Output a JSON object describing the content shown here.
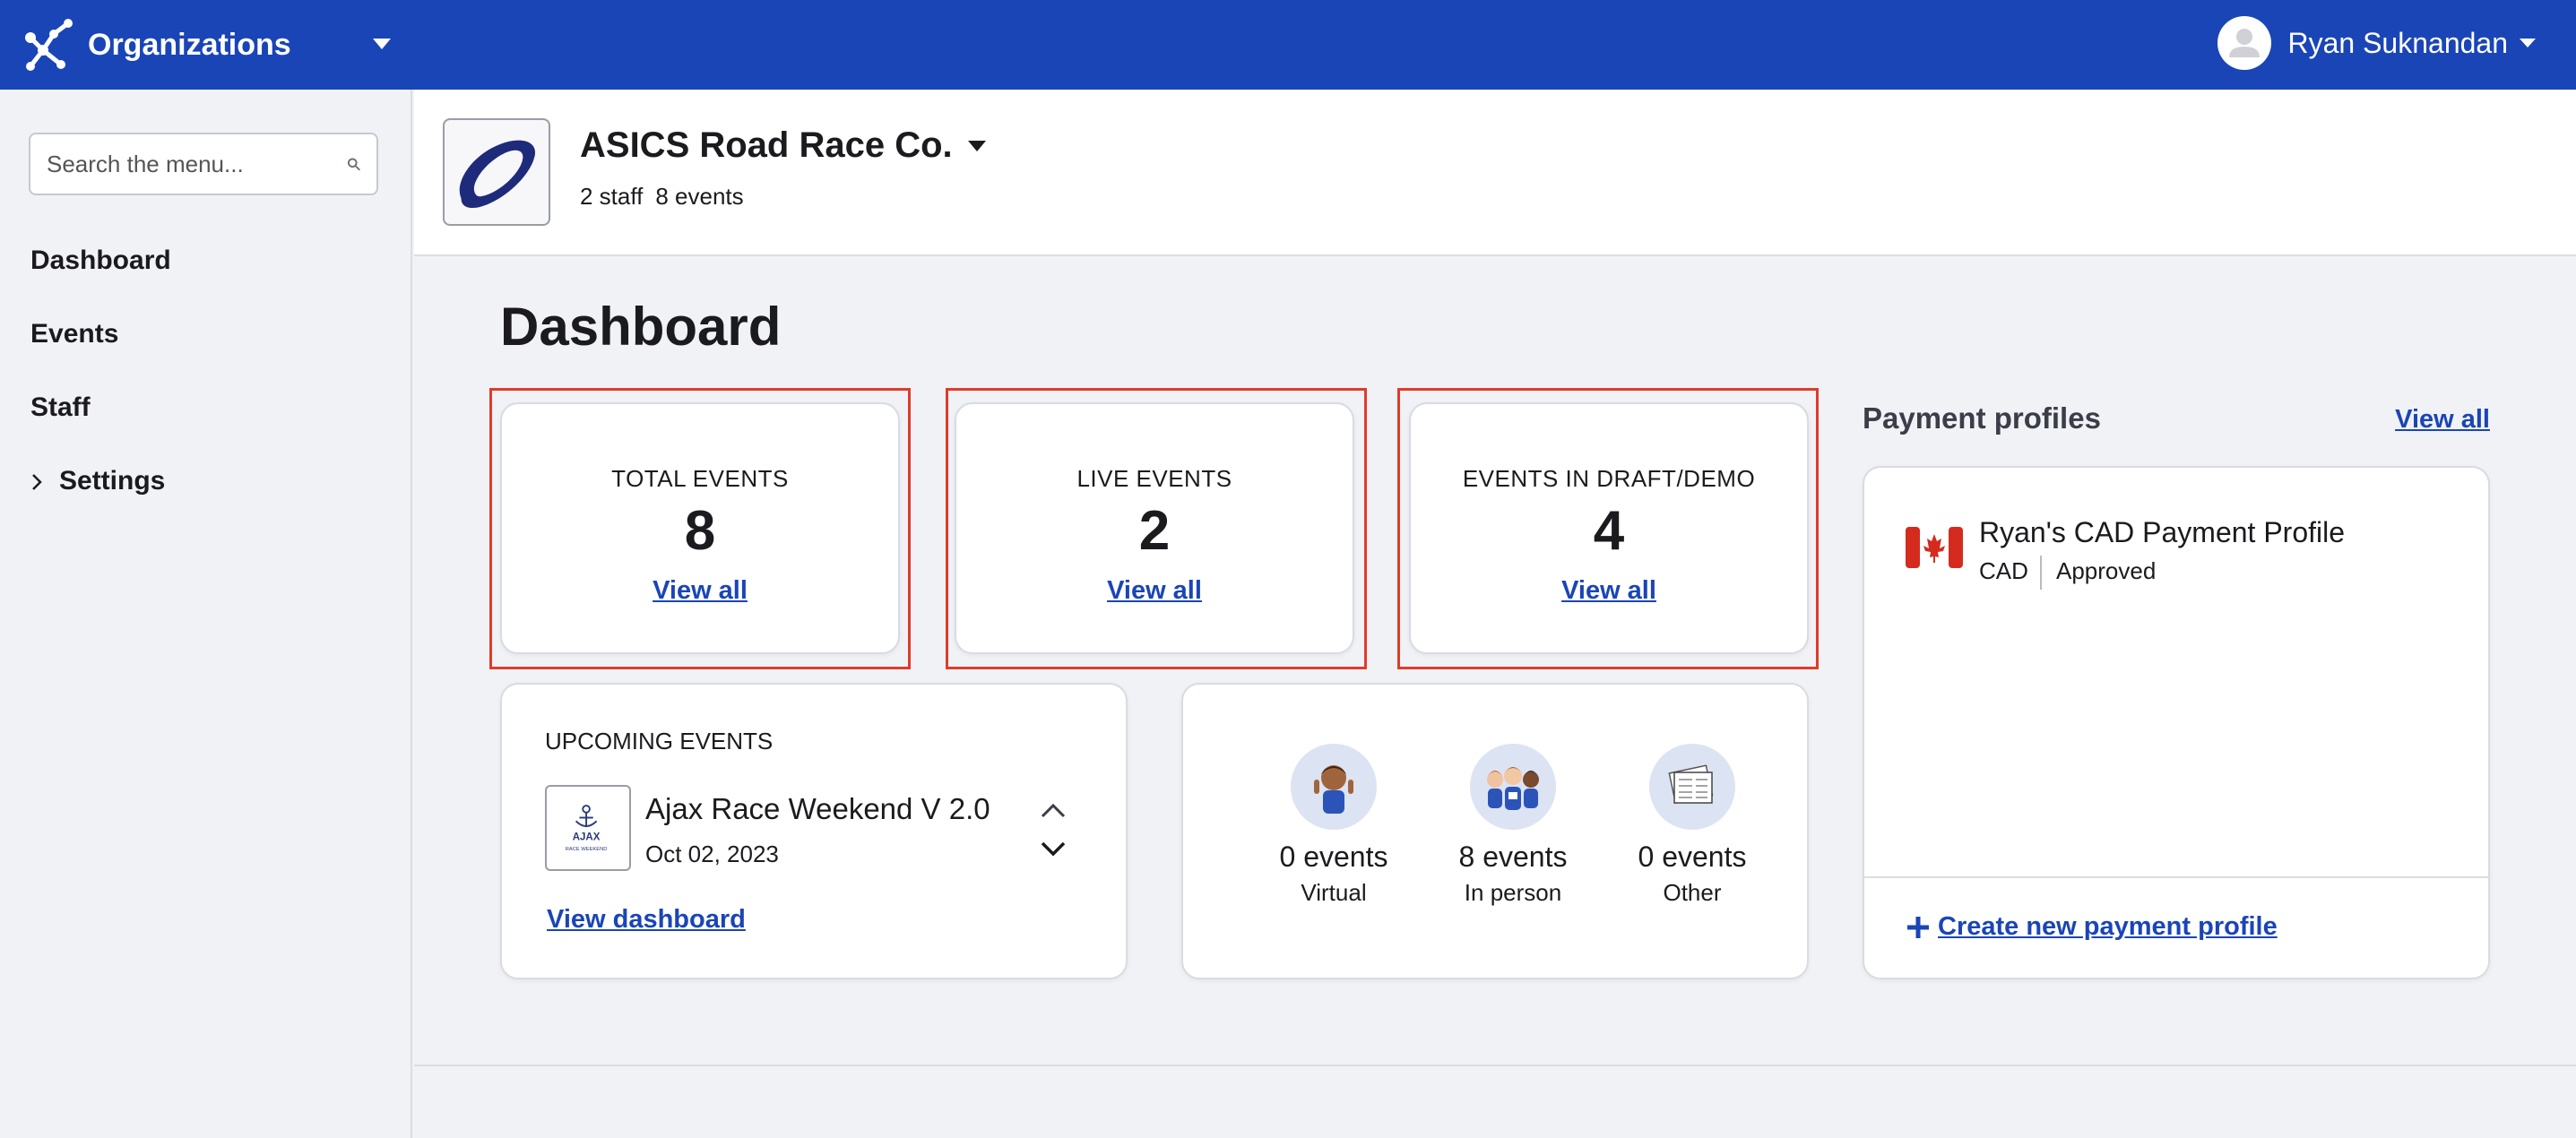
{
  "topbar": {
    "title": "Organizations",
    "user_name": "Ryan Suknandan",
    "brand_color": "#1a45b7"
  },
  "sidebar": {
    "search_placeholder": "Search the menu...",
    "items": [
      {
        "label": "Dashboard"
      },
      {
        "label": "Events"
      },
      {
        "label": "Staff"
      },
      {
        "label": "Settings",
        "expandable": true
      }
    ]
  },
  "org": {
    "name": "ASICS Road Race Co.",
    "staff": "2 staff",
    "events": "8 events"
  },
  "main": {
    "title": "Dashboard",
    "stats": [
      {
        "label": "TOTAL EVENTS",
        "value": "8",
        "link": "View all"
      },
      {
        "label": "LIVE EVENTS",
        "value": "2",
        "link": "View all"
      },
      {
        "label": "EVENTS IN DRAFT/DEMO",
        "value": "4",
        "link": "View all"
      }
    ],
    "highlight_color": "#e13b2a",
    "upcoming": {
      "label": "UPCOMING EVENTS",
      "event_name": "Ajax Race Weekend V 2.0",
      "event_date": "Oct 02, 2023",
      "logo_text": "AJAX",
      "logo_subtext": "RACE WEEKEND",
      "link": "View dashboard"
    },
    "categories": [
      {
        "count": "0 events",
        "label": "Virtual",
        "icon": "runner-waving-icon"
      },
      {
        "count": "8 events",
        "label": "In person",
        "icon": "group-runners-icon"
      },
      {
        "count": "0 events",
        "label": "Other",
        "icon": "documents-icon"
      }
    ]
  },
  "payment": {
    "title": "Payment profiles",
    "view_all": "View all",
    "profile_name": "Ryan's CAD Payment Profile",
    "currency": "CAD",
    "status": "Approved",
    "create_link": "Create new payment profile"
  }
}
